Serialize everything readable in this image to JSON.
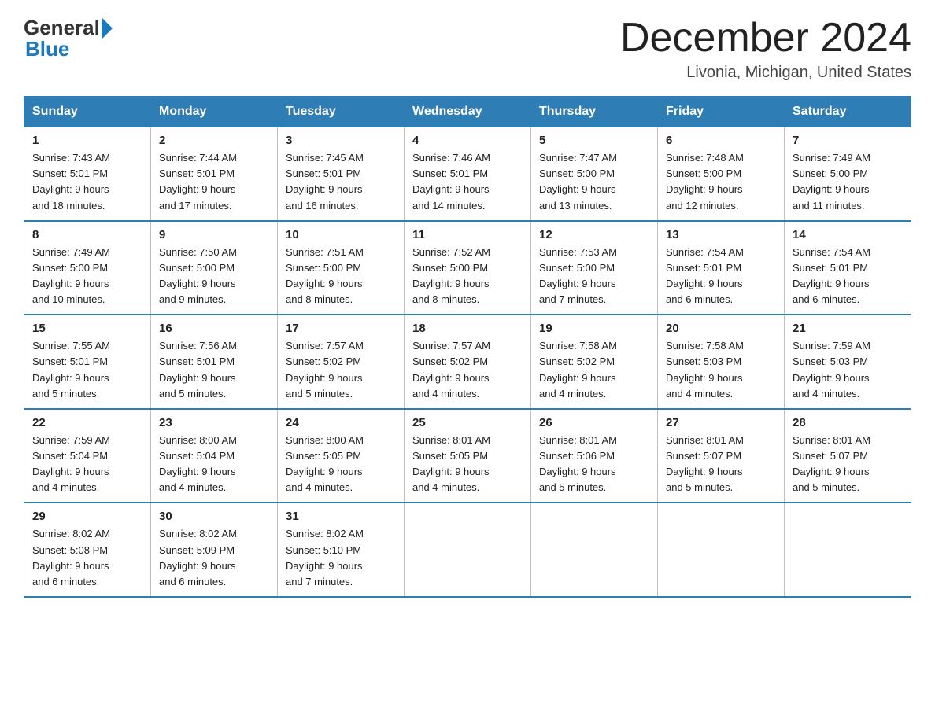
{
  "header": {
    "logo_general": "General",
    "logo_blue": "Blue",
    "month_title": "December 2024",
    "location": "Livonia, Michigan, United States"
  },
  "days_of_week": [
    "Sunday",
    "Monday",
    "Tuesday",
    "Wednesday",
    "Thursday",
    "Friday",
    "Saturday"
  ],
  "weeks": [
    [
      {
        "day": "1",
        "sunrise": "7:43 AM",
        "sunset": "5:01 PM",
        "daylight": "9 hours and 18 minutes."
      },
      {
        "day": "2",
        "sunrise": "7:44 AM",
        "sunset": "5:01 PM",
        "daylight": "9 hours and 17 minutes."
      },
      {
        "day": "3",
        "sunrise": "7:45 AM",
        "sunset": "5:01 PM",
        "daylight": "9 hours and 16 minutes."
      },
      {
        "day": "4",
        "sunrise": "7:46 AM",
        "sunset": "5:01 PM",
        "daylight": "9 hours and 14 minutes."
      },
      {
        "day": "5",
        "sunrise": "7:47 AM",
        "sunset": "5:00 PM",
        "daylight": "9 hours and 13 minutes."
      },
      {
        "day": "6",
        "sunrise": "7:48 AM",
        "sunset": "5:00 PM",
        "daylight": "9 hours and 12 minutes."
      },
      {
        "day": "7",
        "sunrise": "7:49 AM",
        "sunset": "5:00 PM",
        "daylight": "9 hours and 11 minutes."
      }
    ],
    [
      {
        "day": "8",
        "sunrise": "7:49 AM",
        "sunset": "5:00 PM",
        "daylight": "9 hours and 10 minutes."
      },
      {
        "day": "9",
        "sunrise": "7:50 AM",
        "sunset": "5:00 PM",
        "daylight": "9 hours and 9 minutes."
      },
      {
        "day": "10",
        "sunrise": "7:51 AM",
        "sunset": "5:00 PM",
        "daylight": "9 hours and 8 minutes."
      },
      {
        "day": "11",
        "sunrise": "7:52 AM",
        "sunset": "5:00 PM",
        "daylight": "9 hours and 8 minutes."
      },
      {
        "day": "12",
        "sunrise": "7:53 AM",
        "sunset": "5:00 PM",
        "daylight": "9 hours and 7 minutes."
      },
      {
        "day": "13",
        "sunrise": "7:54 AM",
        "sunset": "5:01 PM",
        "daylight": "9 hours and 6 minutes."
      },
      {
        "day": "14",
        "sunrise": "7:54 AM",
        "sunset": "5:01 PM",
        "daylight": "9 hours and 6 minutes."
      }
    ],
    [
      {
        "day": "15",
        "sunrise": "7:55 AM",
        "sunset": "5:01 PM",
        "daylight": "9 hours and 5 minutes."
      },
      {
        "day": "16",
        "sunrise": "7:56 AM",
        "sunset": "5:01 PM",
        "daylight": "9 hours and 5 minutes."
      },
      {
        "day": "17",
        "sunrise": "7:57 AM",
        "sunset": "5:02 PM",
        "daylight": "9 hours and 5 minutes."
      },
      {
        "day": "18",
        "sunrise": "7:57 AM",
        "sunset": "5:02 PM",
        "daylight": "9 hours and 4 minutes."
      },
      {
        "day": "19",
        "sunrise": "7:58 AM",
        "sunset": "5:02 PM",
        "daylight": "9 hours and 4 minutes."
      },
      {
        "day": "20",
        "sunrise": "7:58 AM",
        "sunset": "5:03 PM",
        "daylight": "9 hours and 4 minutes."
      },
      {
        "day": "21",
        "sunrise": "7:59 AM",
        "sunset": "5:03 PM",
        "daylight": "9 hours and 4 minutes."
      }
    ],
    [
      {
        "day": "22",
        "sunrise": "7:59 AM",
        "sunset": "5:04 PM",
        "daylight": "9 hours and 4 minutes."
      },
      {
        "day": "23",
        "sunrise": "8:00 AM",
        "sunset": "5:04 PM",
        "daylight": "9 hours and 4 minutes."
      },
      {
        "day": "24",
        "sunrise": "8:00 AM",
        "sunset": "5:05 PM",
        "daylight": "9 hours and 4 minutes."
      },
      {
        "day": "25",
        "sunrise": "8:01 AM",
        "sunset": "5:05 PM",
        "daylight": "9 hours and 4 minutes."
      },
      {
        "day": "26",
        "sunrise": "8:01 AM",
        "sunset": "5:06 PM",
        "daylight": "9 hours and 5 minutes."
      },
      {
        "day": "27",
        "sunrise": "8:01 AM",
        "sunset": "5:07 PM",
        "daylight": "9 hours and 5 minutes."
      },
      {
        "day": "28",
        "sunrise": "8:01 AM",
        "sunset": "5:07 PM",
        "daylight": "9 hours and 5 minutes."
      }
    ],
    [
      {
        "day": "29",
        "sunrise": "8:02 AM",
        "sunset": "5:08 PM",
        "daylight": "9 hours and 6 minutes."
      },
      {
        "day": "30",
        "sunrise": "8:02 AM",
        "sunset": "5:09 PM",
        "daylight": "9 hours and 6 minutes."
      },
      {
        "day": "31",
        "sunrise": "8:02 AM",
        "sunset": "5:10 PM",
        "daylight": "9 hours and 7 minutes."
      },
      null,
      null,
      null,
      null
    ]
  ],
  "labels": {
    "sunrise": "Sunrise:",
    "sunset": "Sunset:",
    "daylight": "Daylight:"
  }
}
